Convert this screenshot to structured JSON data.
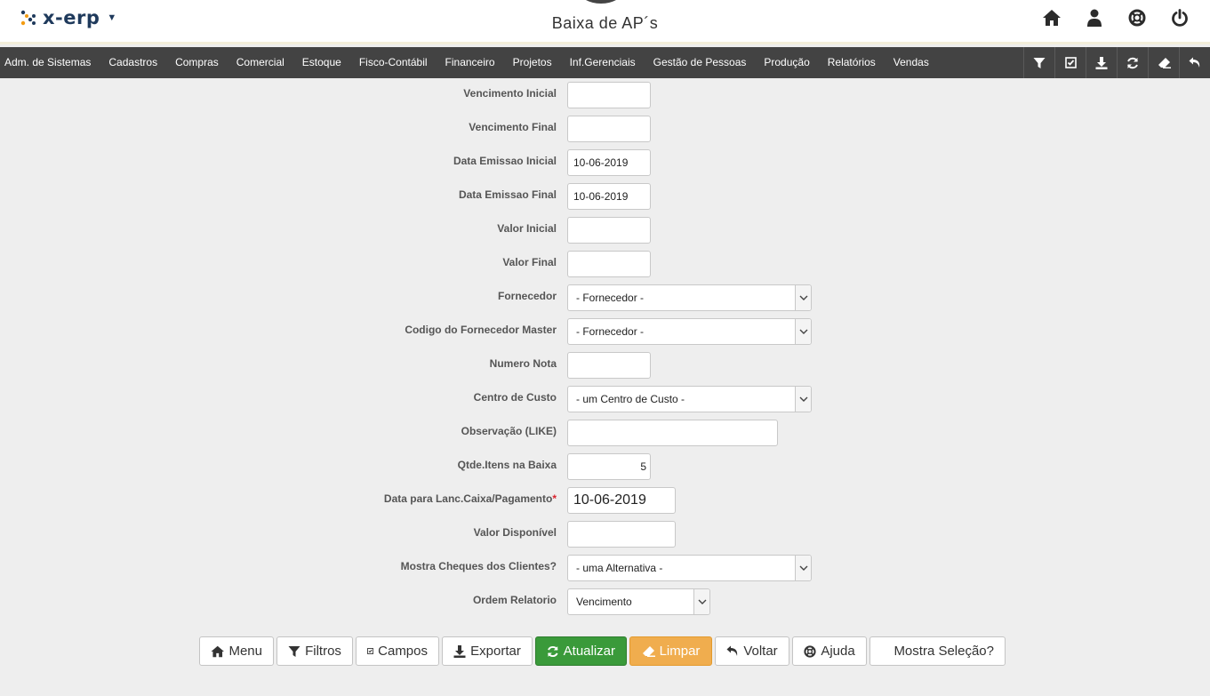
{
  "header": {
    "logo_text": "x-erp",
    "page_title": "Baixa de AP´s",
    "icons": [
      "home-icon",
      "user-icon",
      "lifebuoy-icon",
      "power-icon"
    ]
  },
  "nav": {
    "items": [
      "Adm. de Sistemas",
      "Cadastros",
      "Compras",
      "Comercial",
      "Estoque",
      "Fisco-Contábil",
      "Financeiro",
      "Projetos",
      "Inf.Gerenciais",
      "Gestão de Pessoas",
      "Produção",
      "Relatórios",
      "Vendas"
    ],
    "tools": [
      "filter-icon",
      "checkbox-icon",
      "download-icon",
      "refresh-icon",
      "eraser-icon",
      "undo-icon"
    ]
  },
  "form": {
    "vencimento_inicial": {
      "label": "Vencimento Inicial",
      "value": ""
    },
    "vencimento_final": {
      "label": "Vencimento Final",
      "value": ""
    },
    "data_emissao_inicial": {
      "label": "Data Emissao Inicial",
      "value": "10-06-2019"
    },
    "data_emissao_final": {
      "label": "Data Emissao Final",
      "value": "10-06-2019"
    },
    "valor_inicial": {
      "label": "Valor Inicial",
      "value": ""
    },
    "valor_final": {
      "label": "Valor Final",
      "value": ""
    },
    "fornecedor": {
      "label": "Fornecedor",
      "value": "- Fornecedor -"
    },
    "codigo_fornecedor_master": {
      "label": "Codigo do Fornecedor Master",
      "value": "- Fornecedor -"
    },
    "numero_nota": {
      "label": "Numero Nota",
      "value": ""
    },
    "centro_custo": {
      "label": "Centro de Custo",
      "value": "- um Centro de Custo -"
    },
    "observacao": {
      "label": "Observação (LIKE)",
      "value": ""
    },
    "qtde_itens": {
      "label": "Qtde.Itens na Baixa",
      "value": "5"
    },
    "data_lanc": {
      "label": "Data para Lanc.Caixa/Pagamento",
      "required_mark": "*",
      "value": "10-06-2019"
    },
    "valor_disponivel": {
      "label": "Valor Disponível",
      "value": ""
    },
    "mostra_cheques": {
      "label": "Mostra Cheques dos Clientes?",
      "value": "- uma Alternativa -"
    },
    "ordem_relatorio": {
      "label": "Ordem Relatorio",
      "value": "Vencimento"
    }
  },
  "buttons": {
    "menu": "Menu",
    "filtros": "Filtros",
    "campos": "Campos",
    "exportar": "Exportar",
    "atualizar": "Atualizar",
    "limpar": "Limpar",
    "voltar": "Voltar",
    "ajuda": "Ajuda",
    "mostra_selecao": "Mostra Seleção?"
  },
  "colors": {
    "navbar": "#434343",
    "primary_green": "#3a9a3a",
    "orange": "#f0ad4e",
    "logo_orange": "#f39c12",
    "logo_navy": "#1f3a5c"
  }
}
